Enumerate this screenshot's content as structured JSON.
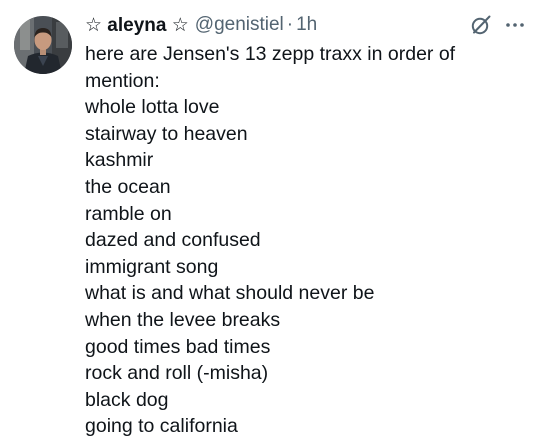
{
  "tweet": {
    "display_name": "☆ aleyna ☆",
    "handle": "@genistiel",
    "separator": "·",
    "time": "1h",
    "lines": [
      "here are Jensen's 13 zepp traxx in order of",
      "mention:",
      "whole lotta love",
      "stairway to heaven",
      "kashmir",
      "the ocean",
      "ramble on",
      "dazed and confused",
      "immigrant song",
      "what is and what should never be",
      "when the levee breaks",
      "good times bad times",
      "rock and roll (-misha)",
      "black dog",
      "going to california"
    ]
  },
  "icons": {
    "avatar": "profile-avatar",
    "grok": "grok-icon",
    "more": "more-options-icon"
  },
  "colors": {
    "text": "#0f1419",
    "secondary": "#536471",
    "background": "#ffffff"
  }
}
